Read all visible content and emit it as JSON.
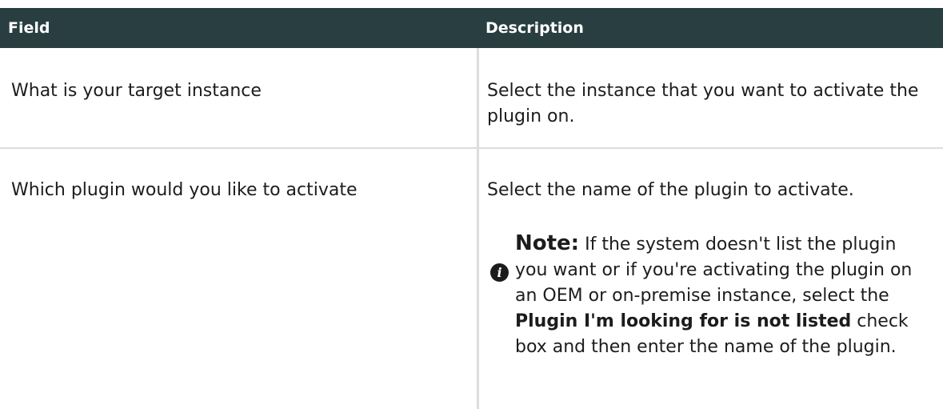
{
  "table": {
    "header": {
      "field": "Field",
      "description": "Description"
    },
    "rows": [
      {
        "field": "What is your target instance",
        "description": "Select the instance that you want to activate the plugin on."
      },
      {
        "field": "Which plugin would you like to activate",
        "description": "Select the name of the plugin to activate.",
        "note": {
          "icon": "info-icon",
          "label": "Note:",
          "text_before": "If the system doesn't list the plugin you want or if you're activating the plugin on an OEM or on-premise instance, select the ",
          "bold": "Plugin I'm looking for is not listed",
          "text_after": " check box and then enter the name of the plugin."
        }
      }
    ]
  },
  "colors": {
    "header_bg": "#293e40",
    "header_text": "#ffffff",
    "rule": "#dcdcdc"
  }
}
